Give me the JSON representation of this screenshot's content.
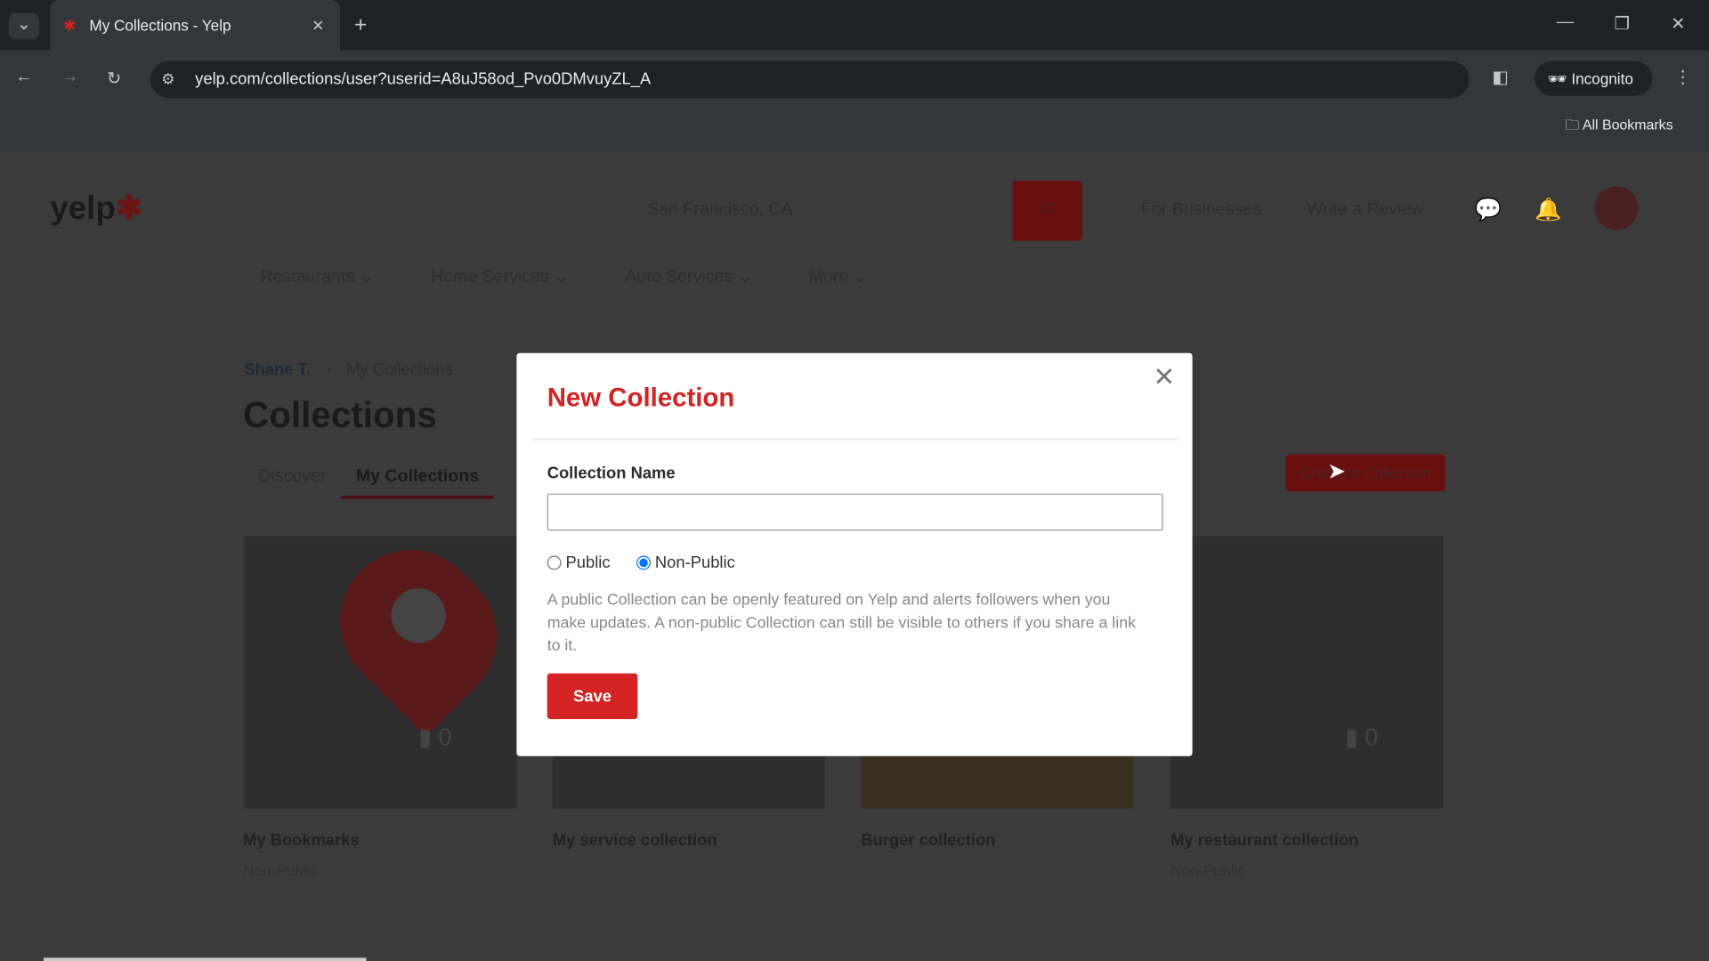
{
  "browser": {
    "tab_title": "My Collections - Yelp",
    "url": "yelp.com/collections/user?userid=A8uJ58od_Pvo0DMvuyZL_A",
    "incognito_label": "Incognito",
    "all_bookmarks": "All Bookmarks"
  },
  "header": {
    "logo": "yelp",
    "location": "San Francisco, CA",
    "for_businesses": "For Businesses",
    "write_review": "Write a Review"
  },
  "nav": [
    "Restaurants",
    "Home Services",
    "Auto Services",
    "More"
  ],
  "breadcrumb": {
    "user": "Shane T.",
    "current": "My Collections"
  },
  "page_title": "Collections",
  "tabs": [
    "Discover",
    "My Collections"
  ],
  "create_button": "Create a Collection",
  "collections": [
    {
      "title": "My Bookmarks",
      "privacy": "Non-Public",
      "count": "0"
    },
    {
      "title": "My service collection",
      "privacy": "",
      "count": ""
    },
    {
      "title": "Burger collection",
      "privacy": "",
      "count": ""
    },
    {
      "title": "My restaurant collection",
      "privacy": "Non-Public",
      "count": "0"
    }
  ],
  "modal": {
    "title": "New Collection",
    "field_label": "Collection Name",
    "field_value": "",
    "options": [
      "Public",
      "Non-Public"
    ],
    "selected": "Non-Public",
    "description": "A public Collection can be openly featured on Yelp and alerts followers when you make updates. A non-public Collection can still be visible to others if you share a link to it.",
    "save": "Save"
  },
  "colors": {
    "brand": "#d32323",
    "dim_overlay": "#3b3b3b"
  }
}
